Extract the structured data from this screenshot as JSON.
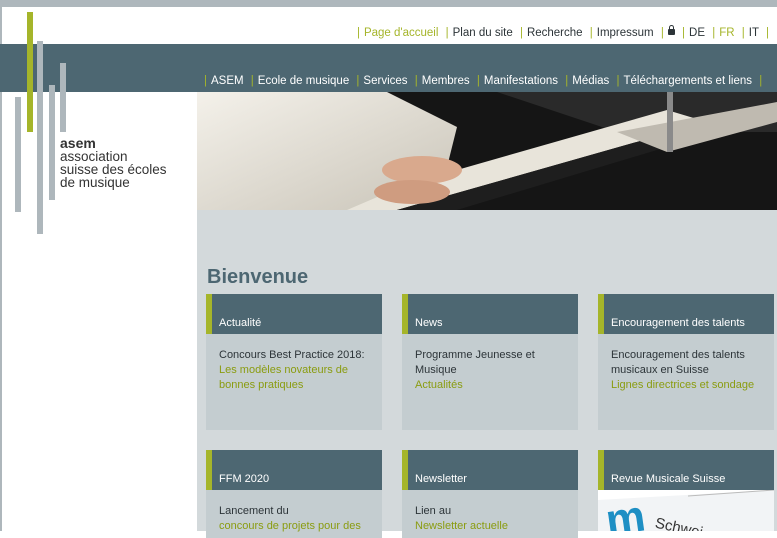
{
  "top_nav": {
    "items": [
      "Page d'accueil",
      "Plan du site",
      "Recherche",
      "Impressum"
    ],
    "languages": [
      "DE",
      "FR",
      "IT"
    ],
    "active_language": "FR",
    "lock_icon": "lock-icon"
  },
  "main_nav": {
    "items": [
      "ASEM",
      "Ecole de musique",
      "Services",
      "Membres",
      "Manifestations",
      "Médias",
      "Téléchargements et liens"
    ]
  },
  "logo": {
    "brand": "asem",
    "line1": "association",
    "line2": "suisse des écoles",
    "line3": "de musique"
  },
  "page": {
    "title": "Bienvenue"
  },
  "cards": [
    {
      "header": "Actualité",
      "text": "Concours Best Practice 2018:",
      "link": "Les modèles novateurs de bonnes pratiques"
    },
    {
      "header": "News",
      "text": "Programme Jeunesse et Musique",
      "link": "Actualités"
    },
    {
      "header": "Encouragement des talents",
      "text": "Encouragement des talents musicaux en Suisse",
      "link": "Lignes directrices et sondage"
    },
    {
      "header": "FFM 2020",
      "text": "Lancement du",
      "link": "concours de projets pour des"
    },
    {
      "header": "Newsletter",
      "text": "Lien au",
      "link": "Newsletter actuelle"
    },
    {
      "header": "Revue Musicale Suisse",
      "image_text": "Schwei"
    }
  ],
  "colors": {
    "accent": "#a5b52a",
    "bar": "#4d6772",
    "panel": "#d3d9db"
  }
}
